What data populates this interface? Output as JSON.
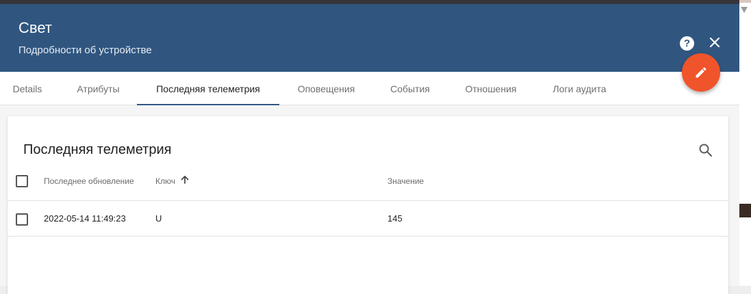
{
  "header": {
    "title": "Свет",
    "subtitle": "Подробности об устройстве",
    "help_label": "?",
    "colors": {
      "header_bg": "#305680",
      "fab_bg": "#f0542a"
    },
    "icons": {
      "help": "help-icon",
      "close": "close-icon",
      "edit": "pencil-icon"
    }
  },
  "tabs": [
    {
      "label": "Details"
    },
    {
      "label": "Атрибуты"
    },
    {
      "label": "Последняя телеметрия",
      "active": true
    },
    {
      "label": "Оповещения"
    },
    {
      "label": "События"
    },
    {
      "label": "Отношения"
    },
    {
      "label": "Логи аудита"
    }
  ],
  "card": {
    "title": "Последняя телеметрия",
    "search_icon": "search-icon",
    "table": {
      "columns": [
        "Последнее обновление",
        "Ключ",
        "Значение"
      ],
      "sort_column": "Ключ",
      "sort_direction": "ascending",
      "rows": [
        {
          "last_update": "2022-05-14 11:49:23",
          "key": "U",
          "value": "145"
        }
      ]
    }
  }
}
